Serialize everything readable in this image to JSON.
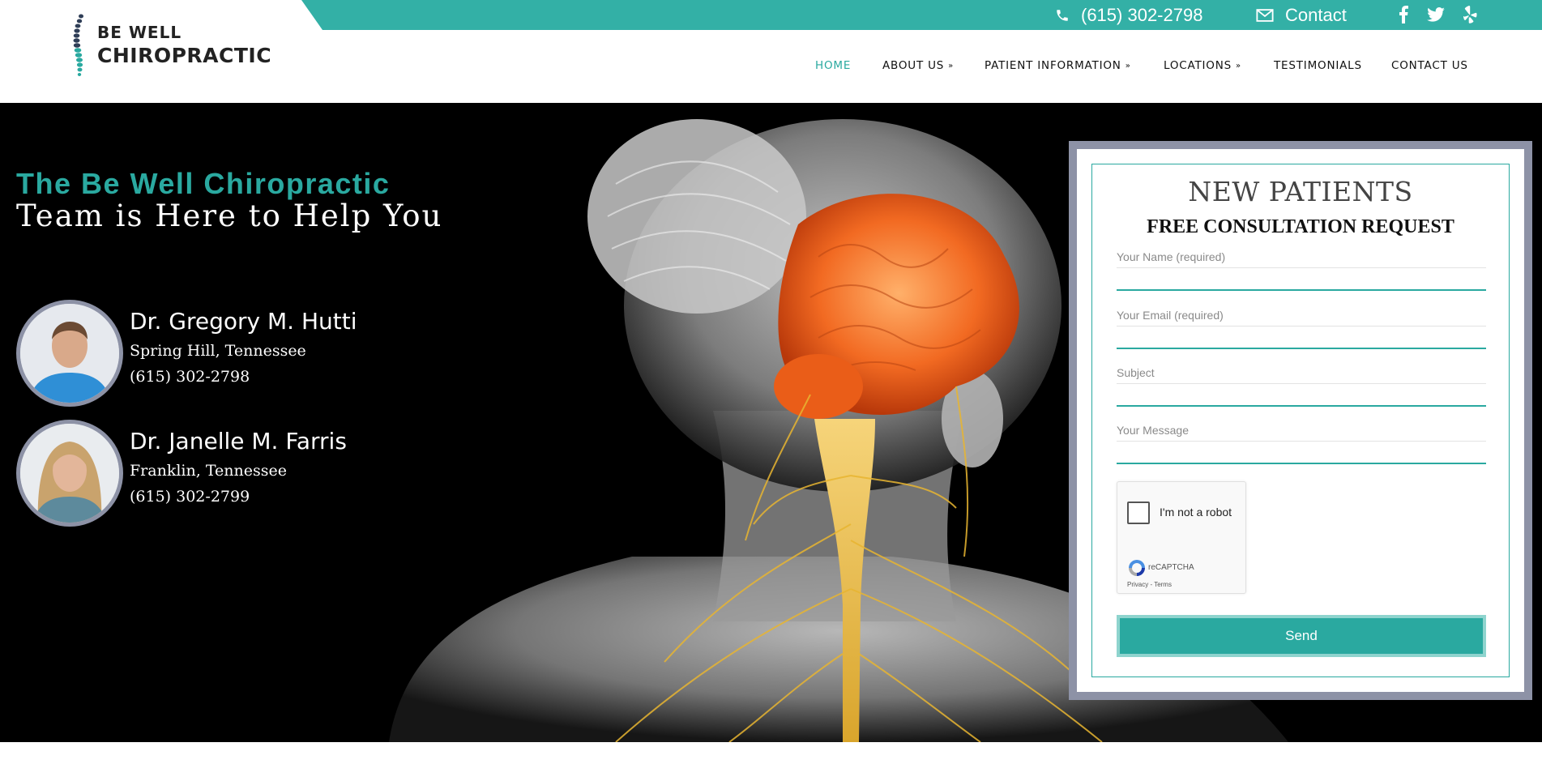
{
  "topbar": {
    "phone": "(615) 302-2798",
    "contact": "Contact",
    "social": [
      "facebook-icon",
      "twitter-icon",
      "yelp-icon"
    ],
    "color": "#33b0a6"
  },
  "logo": {
    "line1": "BE WELL",
    "line2": "CHIROPRACTIC"
  },
  "nav": [
    {
      "label": "HOME",
      "dropdown": false,
      "active": true
    },
    {
      "label": "ABOUT US",
      "dropdown": true
    },
    {
      "label": "PATIENT INFORMATION",
      "dropdown": true
    },
    {
      "label": "LOCATIONS",
      "dropdown": true
    },
    {
      "label": "TESTIMONIALS",
      "dropdown": false
    },
    {
      "label": "CONTACT US",
      "dropdown": false
    }
  ],
  "hero": {
    "headline_line1": "The Be Well Chiropractic",
    "headline_line2": "Team is Here to Help You",
    "doctors": [
      {
        "name": "Dr. Gregory M. Hutti",
        "location": "Spring Hill, Tennessee",
        "phone": "(615) 302-2798"
      },
      {
        "name": "Dr. Janelle M. Farris",
        "location": "Franklin, Tennessee",
        "phone": "(615) 302-2799"
      }
    ]
  },
  "form": {
    "title": "NEW PATIENTS",
    "subtitle": "FREE CONSULTATION REQUEST",
    "fields": [
      "Your Name (required)",
      "Your Email (required)",
      "Subject",
      "Your Message"
    ],
    "captcha_label": "I'm not a robot",
    "captcha_brand": "reCAPTCHA",
    "captcha_terms": "Privacy - Terms",
    "send_label": "Send"
  },
  "colors": {
    "accent": "#2aa9a0",
    "frame": "#8d92a6",
    "hero_bg": "#000000"
  }
}
